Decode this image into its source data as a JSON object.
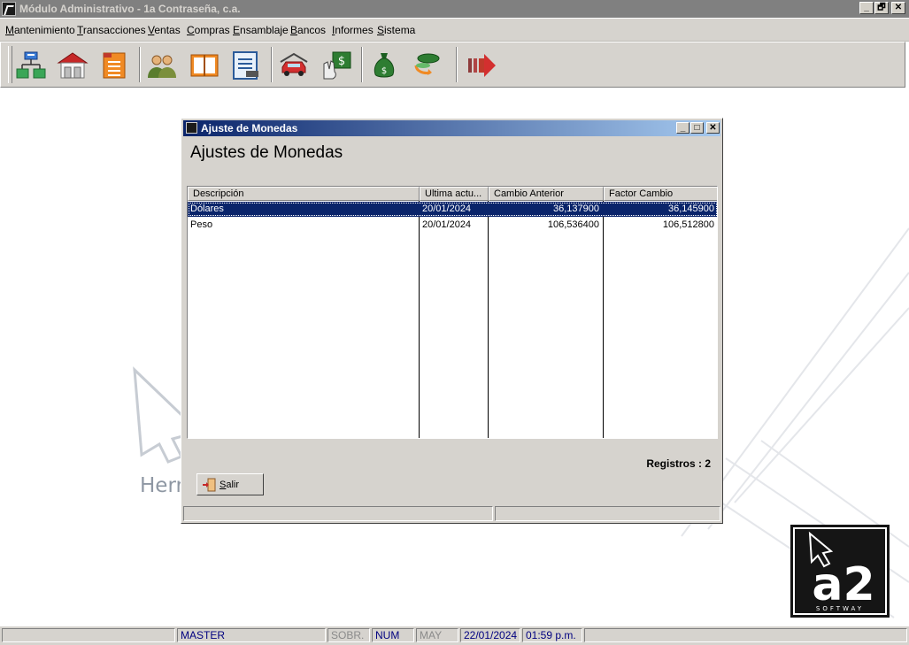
{
  "app": {
    "title": "Módulo Administrativo - 1a Contraseña, c.a.",
    "window_controls": [
      "_",
      "🗗",
      "✕"
    ]
  },
  "menu": {
    "items": [
      "Mantenimiento",
      "Transacciones",
      "Ventas",
      "Compras",
      "Ensamblaje",
      "Bancos",
      "Informes",
      "Sistema"
    ]
  },
  "toolbar": {
    "buttons": [
      {
        "icon": "org-chart-icon"
      },
      {
        "icon": "warehouse-icon"
      },
      {
        "icon": "file-folder-icon"
      },
      {
        "icon": "users-icon"
      },
      {
        "icon": "book-icon"
      },
      {
        "icon": "document-form-icon"
      },
      {
        "icon": "car-icon"
      },
      {
        "icon": "hand-money-icon"
      },
      {
        "icon": "money-bag-icon"
      },
      {
        "icon": "currency-exchange-icon"
      },
      {
        "icon": "exit-arrow-icon"
      }
    ]
  },
  "background": {
    "brand_text": "Herr"
  },
  "dialog": {
    "title": "Ajuste de Monedas",
    "heading": "Ajustes de Monedas",
    "columns": [
      "Descripción",
      "Ultima actu...",
      "Cambio Anterior",
      "Factor Cambio"
    ],
    "rows": [
      {
        "descripcion": "Dólares",
        "fecha": "20/01/2024",
        "anterior": "36,137900",
        "factor": "36,145900",
        "selected": true
      },
      {
        "descripcion": "Peso",
        "fecha": "20/01/2024",
        "anterior": "106,536400",
        "factor": "106,512800",
        "selected": false
      }
    ],
    "registros": "Registros : 2",
    "salir_label": "Salir"
  },
  "logo": {
    "text": "a2",
    "subtext": "SOFTWAY"
  },
  "statusbar": {
    "user": "MASTER",
    "sobr": "SOBR.",
    "num": "NUM",
    "may": "MAY",
    "date": "22/01/2024",
    "time": "01:59 p.m."
  },
  "colors": {
    "selection": "#0a246a",
    "title_gradient_start": "#0a246a",
    "title_gradient_end": "#a6caf0",
    "face": "#d6d3ce"
  }
}
